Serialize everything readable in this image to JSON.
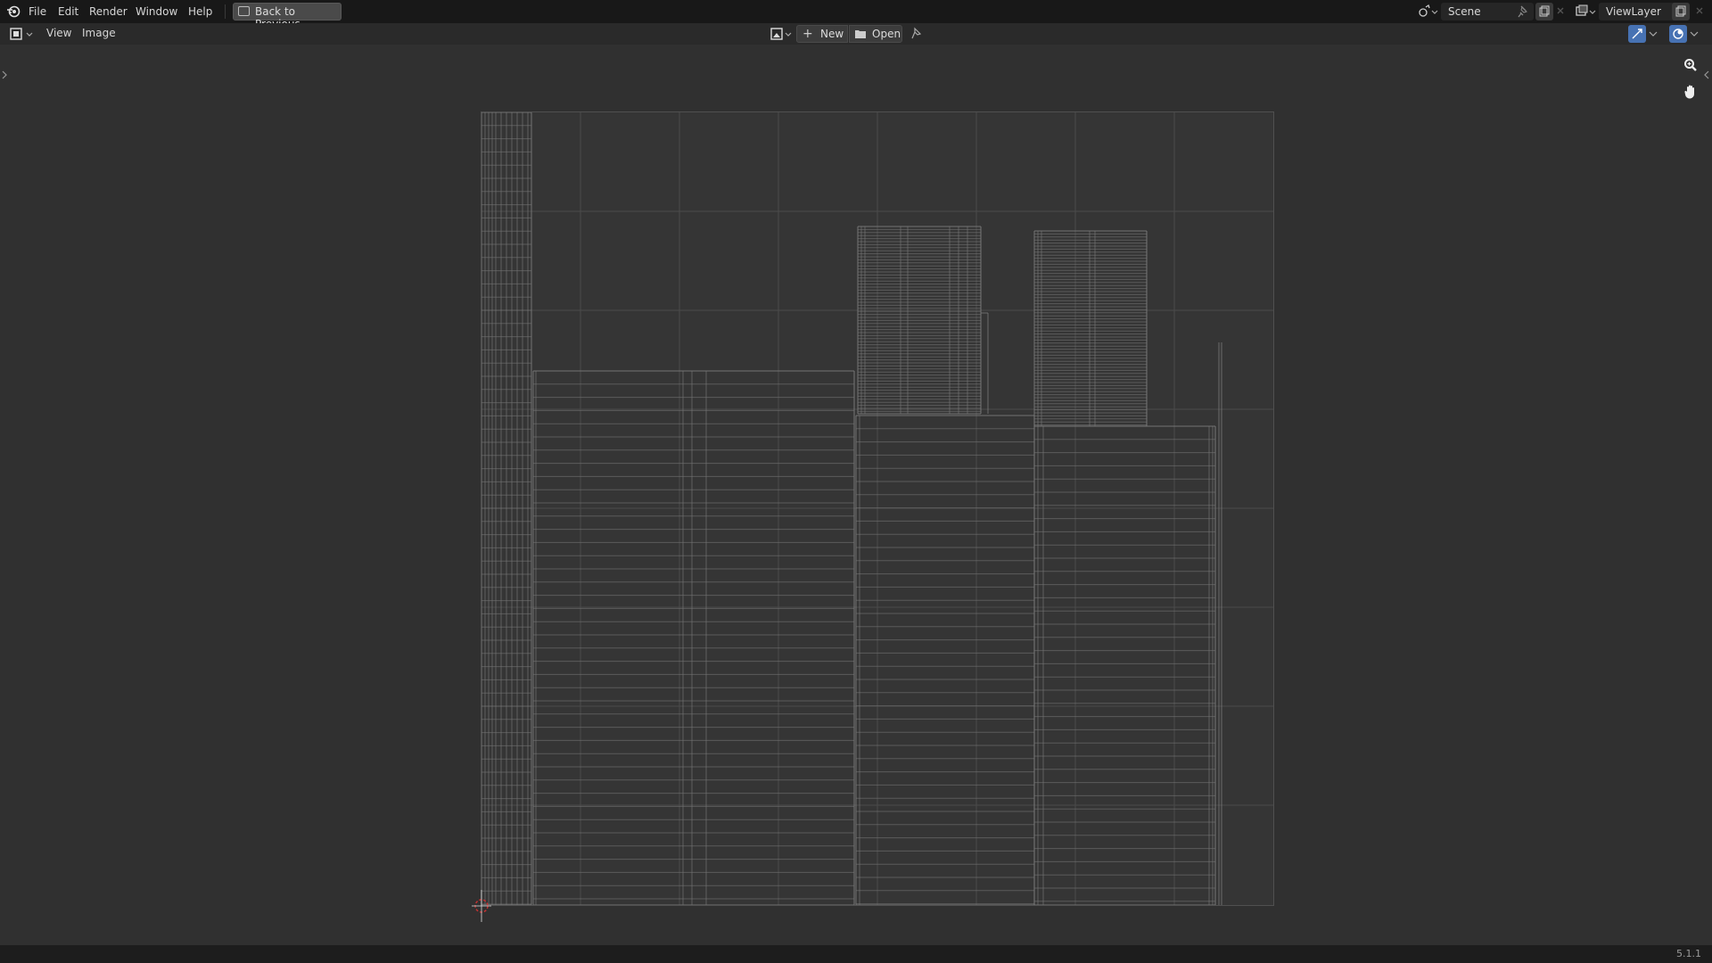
{
  "menu": {
    "items": [
      "File",
      "Edit",
      "Render",
      "Window",
      "Help"
    ],
    "back_label": "Back to Previous"
  },
  "top_right": {
    "scene_label": "Scene",
    "view_layer_label": "ViewLayer"
  },
  "header": {
    "view_label": "View",
    "image_label": "Image",
    "new_label": "New",
    "open_label": "Open"
  },
  "status": {
    "version": "5.1.1"
  },
  "colors": {
    "accent": "#4772b3",
    "wire": "#7a7a7a",
    "cursor": "#c83232"
  }
}
